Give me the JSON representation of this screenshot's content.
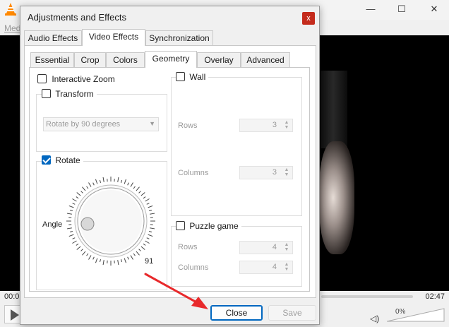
{
  "vlc": {
    "menu_partial": "Med",
    "time_elapsed": "00:0",
    "time_total": "02:47",
    "volume": "0%",
    "controls": {
      "minimize": "—",
      "maximize": "☐",
      "close": "✕"
    }
  },
  "dialog": {
    "title": "Adjustments and Effects",
    "close_glyph": "x",
    "tabs": [
      "Audio Effects",
      "Video Effects",
      "Synchronization"
    ],
    "active_tab": "Video Effects",
    "subtabs": [
      "Essential",
      "Crop",
      "Colors",
      "Geometry",
      "Overlay",
      "Advanced"
    ],
    "active_subtab": "Geometry",
    "geometry": {
      "interactive_zoom": {
        "label": "Interactive Zoom",
        "checked": false
      },
      "transform": {
        "label": "Transform",
        "checked": false,
        "select_value": "Rotate by 90 degrees"
      },
      "rotate": {
        "label": "Rotate",
        "checked": true,
        "angle_label": "Angle",
        "angle_value": "91"
      },
      "wall": {
        "label": "Wall",
        "checked": false,
        "rows_label": "Rows",
        "rows_value": "3",
        "columns_label": "Columns",
        "columns_value": "3"
      },
      "puzzle": {
        "label": "Puzzle game",
        "checked": false,
        "rows_label": "Rows",
        "rows_value": "4",
        "columns_label": "Columns",
        "columns_value": "4"
      }
    },
    "buttons": {
      "close": "Close",
      "save": "Save"
    }
  },
  "colors": {
    "accent": "#0067c0",
    "close_red": "#c42b1c",
    "annotation_arrow": "#e8292b"
  }
}
